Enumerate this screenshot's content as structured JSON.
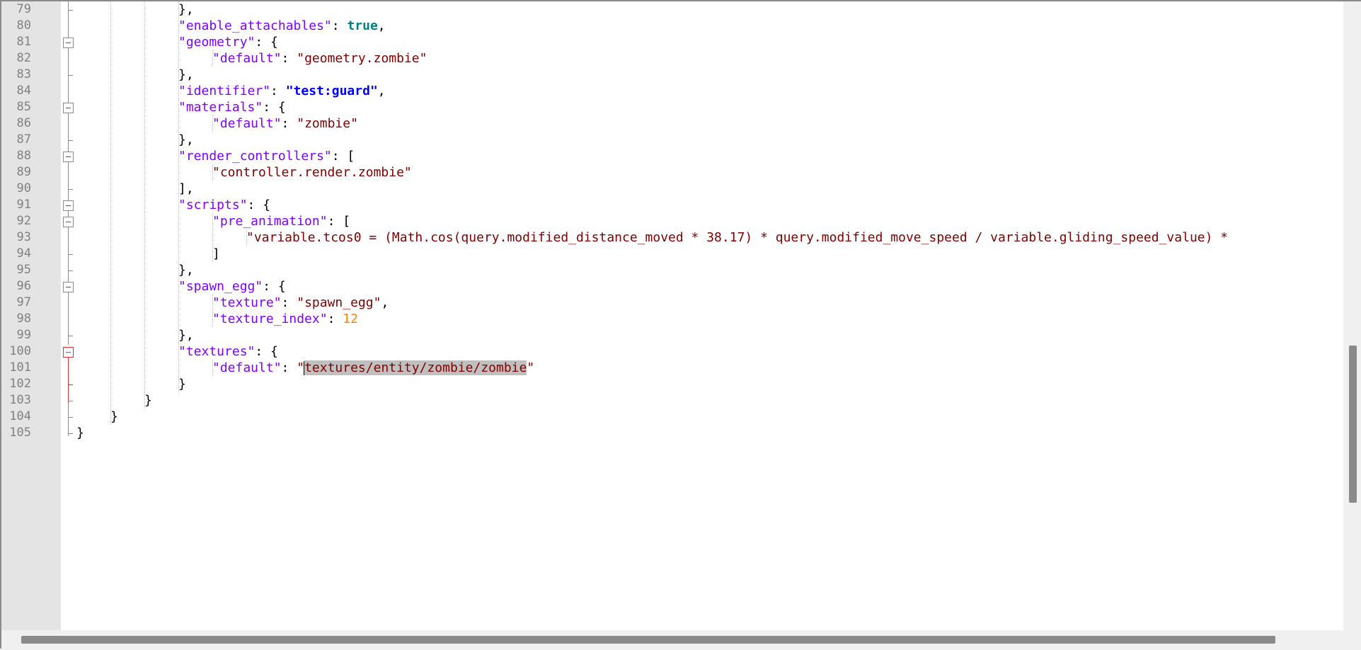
{
  "editor": {
    "language": "json",
    "caret_line": "101",
    "selected_text": "textures/entity/zombie/zombie"
  },
  "lines": [
    {
      "n": "79"
    },
    {
      "n": "80"
    },
    {
      "n": "81"
    },
    {
      "n": "82"
    },
    {
      "n": "83"
    },
    {
      "n": "84"
    },
    {
      "n": "85"
    },
    {
      "n": "86"
    },
    {
      "n": "87"
    },
    {
      "n": "88"
    },
    {
      "n": "89"
    },
    {
      "n": "90"
    },
    {
      "n": "91"
    },
    {
      "n": "92"
    },
    {
      "n": "93"
    },
    {
      "n": "94"
    },
    {
      "n": "95"
    },
    {
      "n": "96"
    },
    {
      "n": "97"
    },
    {
      "n": "98"
    },
    {
      "n": "99"
    },
    {
      "n": "100"
    },
    {
      "n": "101"
    },
    {
      "n": "102"
    },
    {
      "n": "103"
    },
    {
      "n": "104"
    },
    {
      "n": "105"
    }
  ],
  "code": {
    "l79": "},",
    "l80_key": "\"enable_attachables\"",
    "l80_val": "true",
    "l81_key": "\"geometry\"",
    "l82_key": "\"default\"",
    "l82_val": "\"geometry.zombie\"",
    "l83": "},",
    "l84_key": "\"identifier\"",
    "l84_val": "\"test:guard\"",
    "l85_key": "\"materials\"",
    "l86_key": "\"default\"",
    "l86_val": "\"zombie\"",
    "l87": "},",
    "l88_key": "\"render_controllers\"",
    "l89_val": "\"controller.render.zombie\"",
    "l90": "],",
    "l91_key": "\"scripts\"",
    "l92_key": "\"pre_animation\"",
    "l93_val": "\"variable.tcos0 = (Math.cos(query.modified_distance_moved * 38.17) * query.modified_move_speed / variable.gliding_speed_value) * ",
    "l94": "]",
    "l95": "},",
    "l96_key": "\"spawn_egg\"",
    "l97_key": "\"texture\"",
    "l97_val": "\"spawn_egg\"",
    "l98_key": "\"texture_index\"",
    "l98_val": "12",
    "l99": "},",
    "l100_key": "\"textures\"",
    "l101_key": "\"default\"",
    "l101_q1": "\"",
    "l101_sel": "textures/entity/zombie/zombie",
    "l101_q2": "\"",
    "l102": "}",
    "l103": "}",
    "l104": "}",
    "l105": "}"
  },
  "colors": {
    "key": "#8000ff",
    "string": "#800000",
    "bool": "#008080",
    "number": "#ff8000",
    "identifier": "#0000ff",
    "current_line": "#e8e8ff",
    "selection": "#c0c0c0"
  },
  "icons": {
    "fold_toggle": "fold-minus-icon"
  }
}
